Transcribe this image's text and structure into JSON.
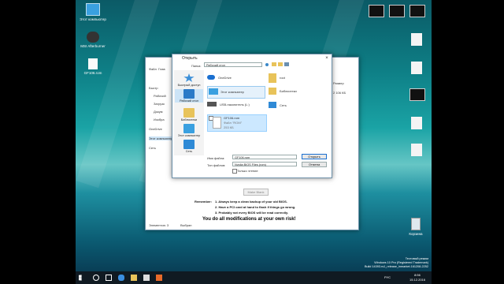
{
  "desktop_icons": [
    {
      "label": "Этот компьютер",
      "name": "this-pc-icon"
    },
    {
      "label": "MSI Afterburner",
      "name": "afterburner-icon"
    },
    {
      "label": "GF106.rom",
      "name": "rom-file-icon"
    }
  ],
  "right_icons": [
    {
      "name": "right-desktop-icon-1"
    },
    {
      "name": "right-desktop-icon-2"
    },
    {
      "name": "right-desktop-icon-3"
    },
    {
      "name": "right-desktop-icon-4"
    },
    {
      "name": "right-desktop-icon-5"
    },
    {
      "name": "right-desktop-icon-6"
    }
  ],
  "recycle_bin": "Корзина",
  "dialog": {
    "title": "Открыть",
    "folder_label": "Папка:",
    "folder_value": "Рабочий стол",
    "places": [
      "Быстрый доступ",
      "Рабочий стол",
      "Библиотеки",
      "Этот компьютер",
      "Сеть"
    ],
    "items": {
      "onedrive": "OneDrive",
      "user": "root",
      "this_pc": "Этот компьютер",
      "libraries": "Библиотеки",
      "usb": "USB-накопитель (L:)",
      "network": "Сеть",
      "file_name": "GF106.rom",
      "file_type": "Файл \"ROM\"",
      "file_size": "253 КБ"
    },
    "filename_label": "Имя файла:",
    "filename_value": "GF106.rom",
    "filetype_label": "Тип файлов:",
    "filetype_value": "Nvidia BIOS Files (rom)",
    "readonly_label": "Только чтение",
    "open_button": "Открыть",
    "cancel_button": "Отмена"
  },
  "explorer": {
    "tabs": [
      "Файл",
      "Глав"
    ],
    "side": [
      "Быстр",
      "Рабочий",
      "Загрузк",
      "Докум",
      "Изобра",
      "OneDrive",
      "Этот компьютер",
      "Сеть"
    ],
    "status_left": "Элементов: 3",
    "status_mid": "Выбран",
    "right_size": "2 106 КБ",
    "right_text": "Размер"
  },
  "app": {
    "button": "Make Blank",
    "remember_label": "Remember:",
    "tips": [
      "1. Always keep a clean backup of your old BIOS.",
      "2. Have a PCI card at hand to flash if things go wrong.",
      "3. Probably not every BIOS will be read correctly."
    ],
    "warning": "You do all modifications at your own risk!"
  },
  "watermark": {
    "line1": "Тестовый режим",
    "line2": "Windows 10 Pro (Registered Trademark)",
    "line3": "Build 14393.rs1_release_inmarket.161208-2252"
  },
  "clock": {
    "time": "8:56",
    "date": "15.12.2016",
    "lang": "РУС"
  }
}
